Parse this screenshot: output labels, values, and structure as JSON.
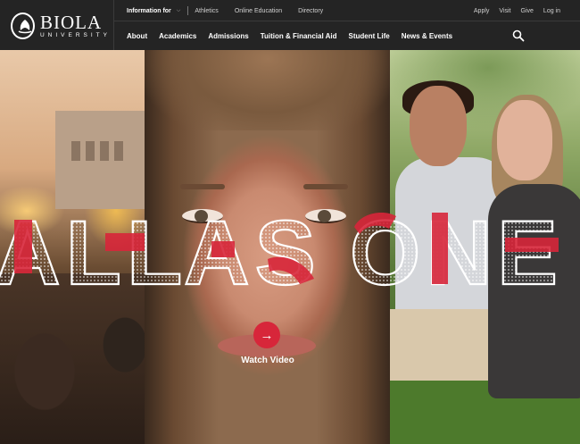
{
  "header": {
    "logo": {
      "name": "BIOLA",
      "subtitle": "UNIVERSITY",
      "icon": "biola-seal-icon"
    },
    "utility_left": {
      "info_label": "Information for",
      "links": [
        "Athletics",
        "Online Education",
        "Directory"
      ]
    },
    "utility_right": [
      "Apply",
      "Visit",
      "Give",
      "Log in"
    ],
    "main_nav": [
      "About",
      "Academics",
      "Admissions",
      "Tuition & Financial Aid",
      "Student Life",
      "News & Events"
    ],
    "search_icon": "search-icon"
  },
  "hero": {
    "headline_words": [
      "ALL",
      "AS",
      "ONE"
    ],
    "headline_text": "ALL AS ONE",
    "accent_color": "#d7263a",
    "watch_video_label": "Watch Video",
    "watch_icon": "arrow-right-icon"
  }
}
